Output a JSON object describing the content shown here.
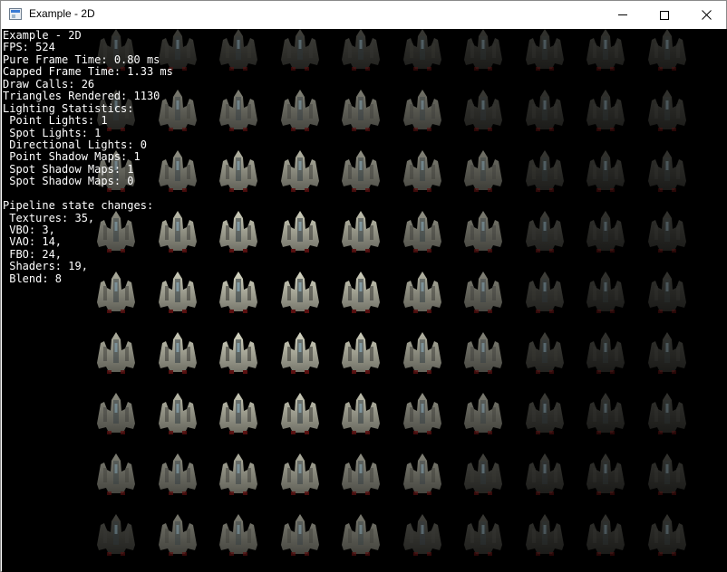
{
  "window": {
    "title": "Example - 2D",
    "icon": "app-window-icon",
    "controls": [
      "minimize-icon",
      "maximize-icon",
      "close-icon"
    ]
  },
  "viewport": {
    "background": "#000000",
    "sprite": "spaceship-sprite",
    "grid_columns": 10,
    "grid_rows": 9,
    "lit_color": "#d8d8c4",
    "dim_color": "#6f6f66"
  },
  "stats": {
    "lines": [
      "Example - 2D",
      "FPS: 524",
      "Pure Frame Time: 0.80 ms",
      "Capped Frame Time: 1.33 ms",
      "Draw Calls: 26",
      "Triangles Rendered: 1130",
      "Lighting Statistics:",
      " Point Lights: 1",
      " Spot Lights: 1",
      " Directional Lights: 0",
      " Point Shadow Maps: 1",
      " Spot Shadow Maps: 1",
      " Spot Shadow Maps: 0",
      "",
      "Pipeline state changes:",
      " Textures: 35,",
      " VBO: 3,",
      " VAO: 14,",
      " FBO: 24,",
      " Shaders: 19,",
      " Blend: 8"
    ]
  }
}
